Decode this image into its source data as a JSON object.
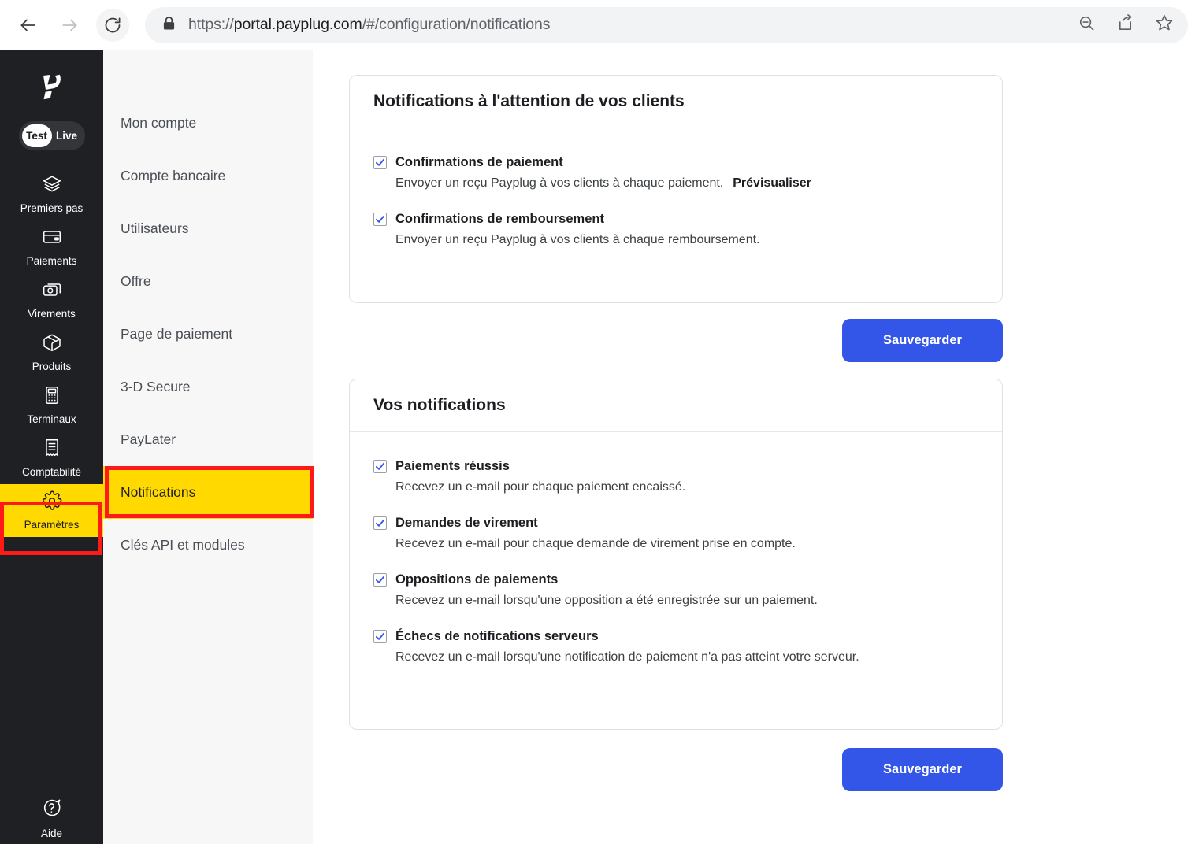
{
  "browser": {
    "url_prefix": "https://",
    "url_host": "portal.payplug.com",
    "url_path": "/#/configuration/notifications",
    "back_icon": "back-arrow-icon",
    "forward_icon": "forward-arrow-icon",
    "reload_icon": "reload-icon",
    "lock_icon": "lock-icon",
    "zoom_out_icon": "zoom-out-icon",
    "share_icon": "share-icon",
    "bookmark_icon": "bookmark-star-icon"
  },
  "rail": {
    "logo": "payplug-logo",
    "env_toggle": {
      "test": "Test",
      "live": "Live",
      "active": "Test"
    },
    "items": [
      {
        "label": "Premiers pas",
        "icon": "layers-icon",
        "active": false
      },
      {
        "label": "Paiements",
        "icon": "credit-card-icon",
        "active": false
      },
      {
        "label": "Virements",
        "icon": "transfers-icon",
        "active": false
      },
      {
        "label": "Produits",
        "icon": "box-icon",
        "active": false
      },
      {
        "label": "Terminaux",
        "icon": "terminal-icon",
        "active": false
      },
      {
        "label": "Comptabilité",
        "icon": "receipt-icon",
        "active": false
      },
      {
        "label": "Paramètres",
        "icon": "gear-icon",
        "active": true
      }
    ],
    "help": {
      "label": "Aide",
      "icon": "help-bubble-icon"
    }
  },
  "subnav": {
    "items": [
      {
        "label": "Mon compte",
        "active": false
      },
      {
        "label": "Compte bancaire",
        "active": false
      },
      {
        "label": "Utilisateurs",
        "active": false
      },
      {
        "label": "Offre",
        "active": false
      },
      {
        "label": "Page de paiement",
        "active": false
      },
      {
        "label": "3-D Secure",
        "active": false
      },
      {
        "label": "PayLater",
        "active": false
      },
      {
        "label": "Notifications",
        "active": true
      },
      {
        "label": "Clés API et modules",
        "active": false
      }
    ]
  },
  "cards": [
    {
      "title": "Notifications à l'attention de vos clients",
      "options": [
        {
          "label": "Confirmations de paiement",
          "desc": "Envoyer un reçu Payplug à vos clients à chaque paiement.",
          "link": "Prévisualiser",
          "checked": true
        },
        {
          "label": "Confirmations de remboursement",
          "desc": "Envoyer un reçu Payplug à vos clients à chaque remboursement.",
          "link": "",
          "checked": true
        }
      ],
      "save_label": "Sauvegarder"
    },
    {
      "title": "Vos notifications",
      "options": [
        {
          "label": "Paiements réussis",
          "desc": "Recevez un e-mail pour chaque paiement encaissé.",
          "link": "",
          "checked": true
        },
        {
          "label": "Demandes de virement",
          "desc": "Recevez un e-mail pour chaque demande de virement prise en compte.",
          "link": "",
          "checked": true
        },
        {
          "label": "Oppositions de paiements",
          "desc": "Recevez un e-mail lorsqu'une opposition a été enregistrée sur un paiement.",
          "link": "",
          "checked": true
        },
        {
          "label": "Échecs de notifications serveurs",
          "desc": "Recevez un e-mail lorsqu'une notification de paiement n'a pas atteint votre serveur.",
          "link": "",
          "checked": true
        }
      ],
      "save_label": "Sauvegarder"
    }
  ],
  "colors": {
    "rail_bg": "#1f2023",
    "subnav_bg": "#f7f7f7",
    "highlight_yellow": "#FFD900",
    "annotation_red": "#FF1A1A",
    "primary_blue": "#3355e8",
    "checkbox_blue": "#3355e8"
  }
}
